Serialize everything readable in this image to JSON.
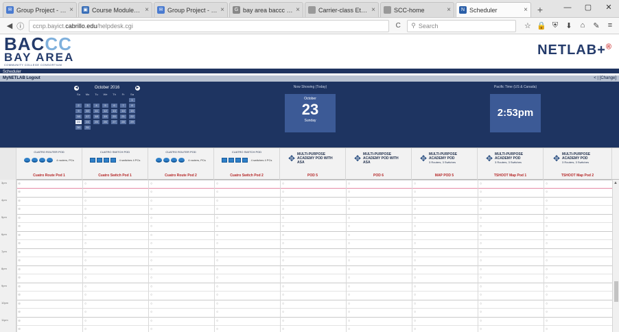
{
  "browser": {
    "tabs": [
      {
        "label": "Group Project - E...",
        "fav_color": "#4a7bd0",
        "fav_glyph": "✉",
        "active": false
      },
      {
        "label": "Course Modules:...",
        "fav_color": "#3a6fb8",
        "fav_glyph": "▣",
        "active": false
      },
      {
        "label": "Group Project - E...",
        "fav_color": "#4a7bd0",
        "fav_glyph": "✉",
        "active": false
      },
      {
        "label": "bay area baccc n...",
        "fav_color": "#888888",
        "fav_glyph": "G",
        "active": false
      },
      {
        "label": "Carrier-class Ethernet...",
        "fav_color": "#999999",
        "fav_glyph": "",
        "active": false
      },
      {
        "label": "SCC-home",
        "fav_color": "#999999",
        "fav_glyph": "",
        "active": false
      },
      {
        "label": "Scheduler",
        "fav_color": "#2b5fa8",
        "fav_glyph": "N",
        "active": true
      }
    ],
    "new_tab_glyph": "+",
    "window_controls": [
      "—",
      "▢",
      "✕"
    ],
    "url": {
      "prefix": "ccnp.bayict.",
      "host": "cabrillo.edu",
      "path": "/helpdesk.cgi"
    },
    "search_placeholder": "Search",
    "back_glyph": "◀",
    "info_glyph": "ⓘ",
    "reload_glyph": "C",
    "toolbar_glyphs": [
      "☆",
      "🔒",
      "⛨",
      "⬇",
      "⌂",
      "✎",
      "≡"
    ]
  },
  "site": {
    "logo": {
      "line1a": "BAC",
      "line1b": "CC",
      "line2": "BAY AREA",
      "line3": "COMMUNITY COLLEGE CONSORTIUM"
    },
    "brand": "NETLAB+",
    "brand_mark": "®",
    "nav_scheduler": "Scheduler",
    "nav_left": "MyNETLAB  Logout",
    "nav_right": "< | [Change]"
  },
  "calendar": {
    "month": "October 2016",
    "dow": [
      "Su",
      "Mo",
      "Tu",
      "We",
      "Th",
      "Fr",
      "Sa"
    ],
    "selected_day": "23",
    "days": [
      "",
      "",
      "",
      "",
      "",
      "",
      "1",
      "2",
      "3",
      "4",
      "5",
      "6",
      "7",
      "8",
      "9",
      "10",
      "11",
      "12",
      "13",
      "14",
      "15",
      "16",
      "17",
      "18",
      "19",
      "20",
      "21",
      "22",
      "23",
      "24",
      "25",
      "26",
      "27",
      "28",
      "29",
      "30",
      "31",
      "",
      "",
      "",
      "",
      ""
    ]
  },
  "now_showing": {
    "label": "Now Showing (Today)",
    "month": "October",
    "day": "23",
    "weekday": "Sunday"
  },
  "clock": {
    "label": "Pacific Time (US & Canada)",
    "time": "2:53pm"
  },
  "pods": [
    {
      "title": "CUATRO ROUTER POD",
      "desc": "4 routers, PCs",
      "name": "Cuatro Route Pod 1",
      "kind": "router"
    },
    {
      "title": "CUATRO SWITCH POD",
      "desc": "4 switches 4 PCs",
      "name": "Cuatro Switch Pod 1",
      "kind": "switch"
    },
    {
      "title": "CUATRO ROUTER POD",
      "desc": "4 routers, PCs",
      "name": "Cuatro Route Pod 2",
      "kind": "router"
    },
    {
      "title": "CUATRO SWITCH POD",
      "desc": "4 switches 4 PCs",
      "name": "Cuatro Switch Pod 2",
      "kind": "switch"
    },
    {
      "title": "MULTI-PURPOSE ACADEMY POD WITH ASA",
      "desc": "",
      "name": "POD 5",
      "kind": "mp"
    },
    {
      "title": "MULTI-PURPOSE ACADEMY POD WITH ASA",
      "desc": "",
      "name": "POD 6",
      "kind": "mp"
    },
    {
      "title": "MULTI-PURPOSE ACADEMY POD",
      "desc": "3 Routers, 3 Switches",
      "name": "MAP POD 5",
      "kind": "mp"
    },
    {
      "title": "MULTI-PURPOSE ACADEMY POD",
      "desc": "3 Routers, 3 Switches",
      "name": "TSHOOT Map Pod 1",
      "kind": "mp"
    },
    {
      "title": "MULTI-PURPOSE ACADEMY POD",
      "desc": "3 Routers, 3 Switches",
      "name": "TSHOOT Map Pod 2",
      "kind": "mp"
    }
  ],
  "time_slots": [
    "3pm",
    "4pm",
    "5pm",
    "6pm",
    "7pm",
    "8pm",
    "9pm",
    "10pm",
    "11pm"
  ],
  "cell_mark": "○",
  "colors": {
    "navy": "#1e3461",
    "tile": "#3c5a96",
    "accent_red": "#b52727",
    "now_line": "#e58aa5"
  }
}
